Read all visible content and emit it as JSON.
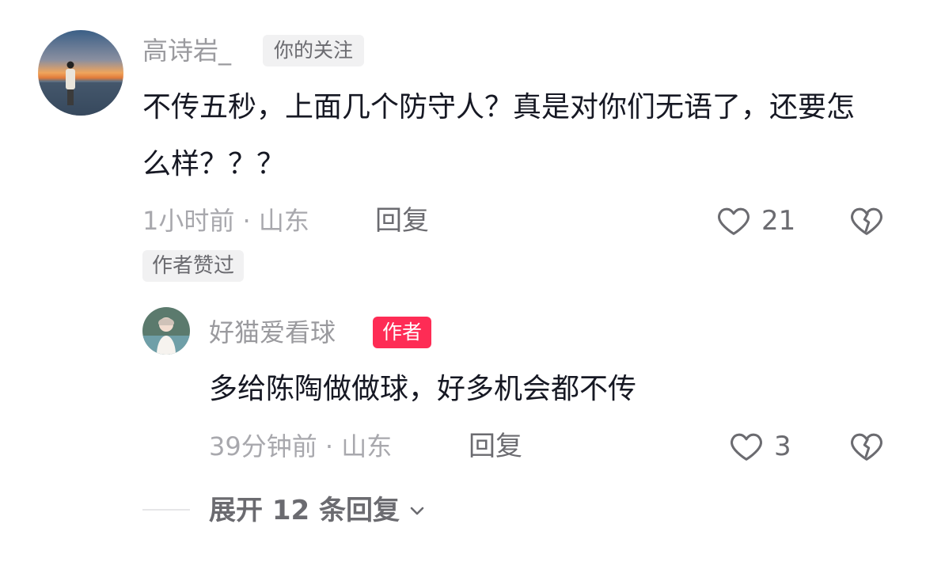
{
  "comment": {
    "username": "高诗岩_",
    "follow_tag": "你的关注",
    "text": "不传五秒，上面几个防守人？真是对你们无语了，还要怎么样？？？",
    "time_location": "1小时前 · 山东",
    "reply_label": "回复",
    "like_count": "21",
    "author_liked_badge": "作者赞过"
  },
  "reply": {
    "username": "好猫爱看球",
    "author_tag": "作者",
    "text": "多给陈陶做做球，好多机会都不传",
    "time_location": "39分钟前 · 山东",
    "reply_label": "回复",
    "like_count": "3"
  },
  "expand_replies_label": "展开 12 条回复",
  "colors": {
    "author_tag": "#fe2c55",
    "username": "#9a9a9e",
    "text": "#161823"
  },
  "icons": [
    "heart-outline-icon",
    "broken-heart-icon",
    "chevron-down-icon"
  ]
}
